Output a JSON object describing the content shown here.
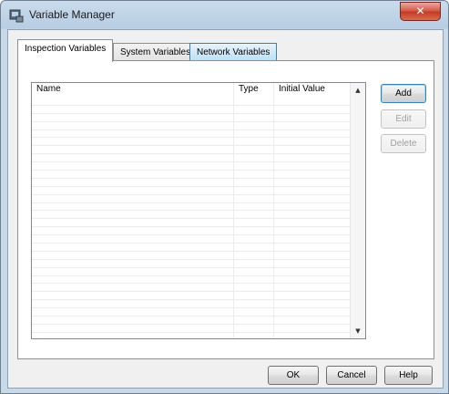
{
  "window": {
    "title": "Variable Manager",
    "close_glyph": "✕",
    "icon": "app-icon"
  },
  "tabs": [
    {
      "label": "Inspection Variables",
      "state": "active"
    },
    {
      "label": "System Variables",
      "state": "normal"
    },
    {
      "label": "Network Variables",
      "state": "hover"
    }
  ],
  "table": {
    "columns": [
      "Name",
      "Type",
      "Initial Value"
    ],
    "rows": []
  },
  "side_buttons": {
    "add": "Add",
    "edit": "Edit",
    "delete": "Delete"
  },
  "footer_buttons": {
    "ok": "OK",
    "cancel": "Cancel",
    "help": "Help"
  },
  "colors": {
    "title_bar": "#b7cde2",
    "close_button": "#c33b24",
    "active_tab_hover": "#bde0f6"
  }
}
